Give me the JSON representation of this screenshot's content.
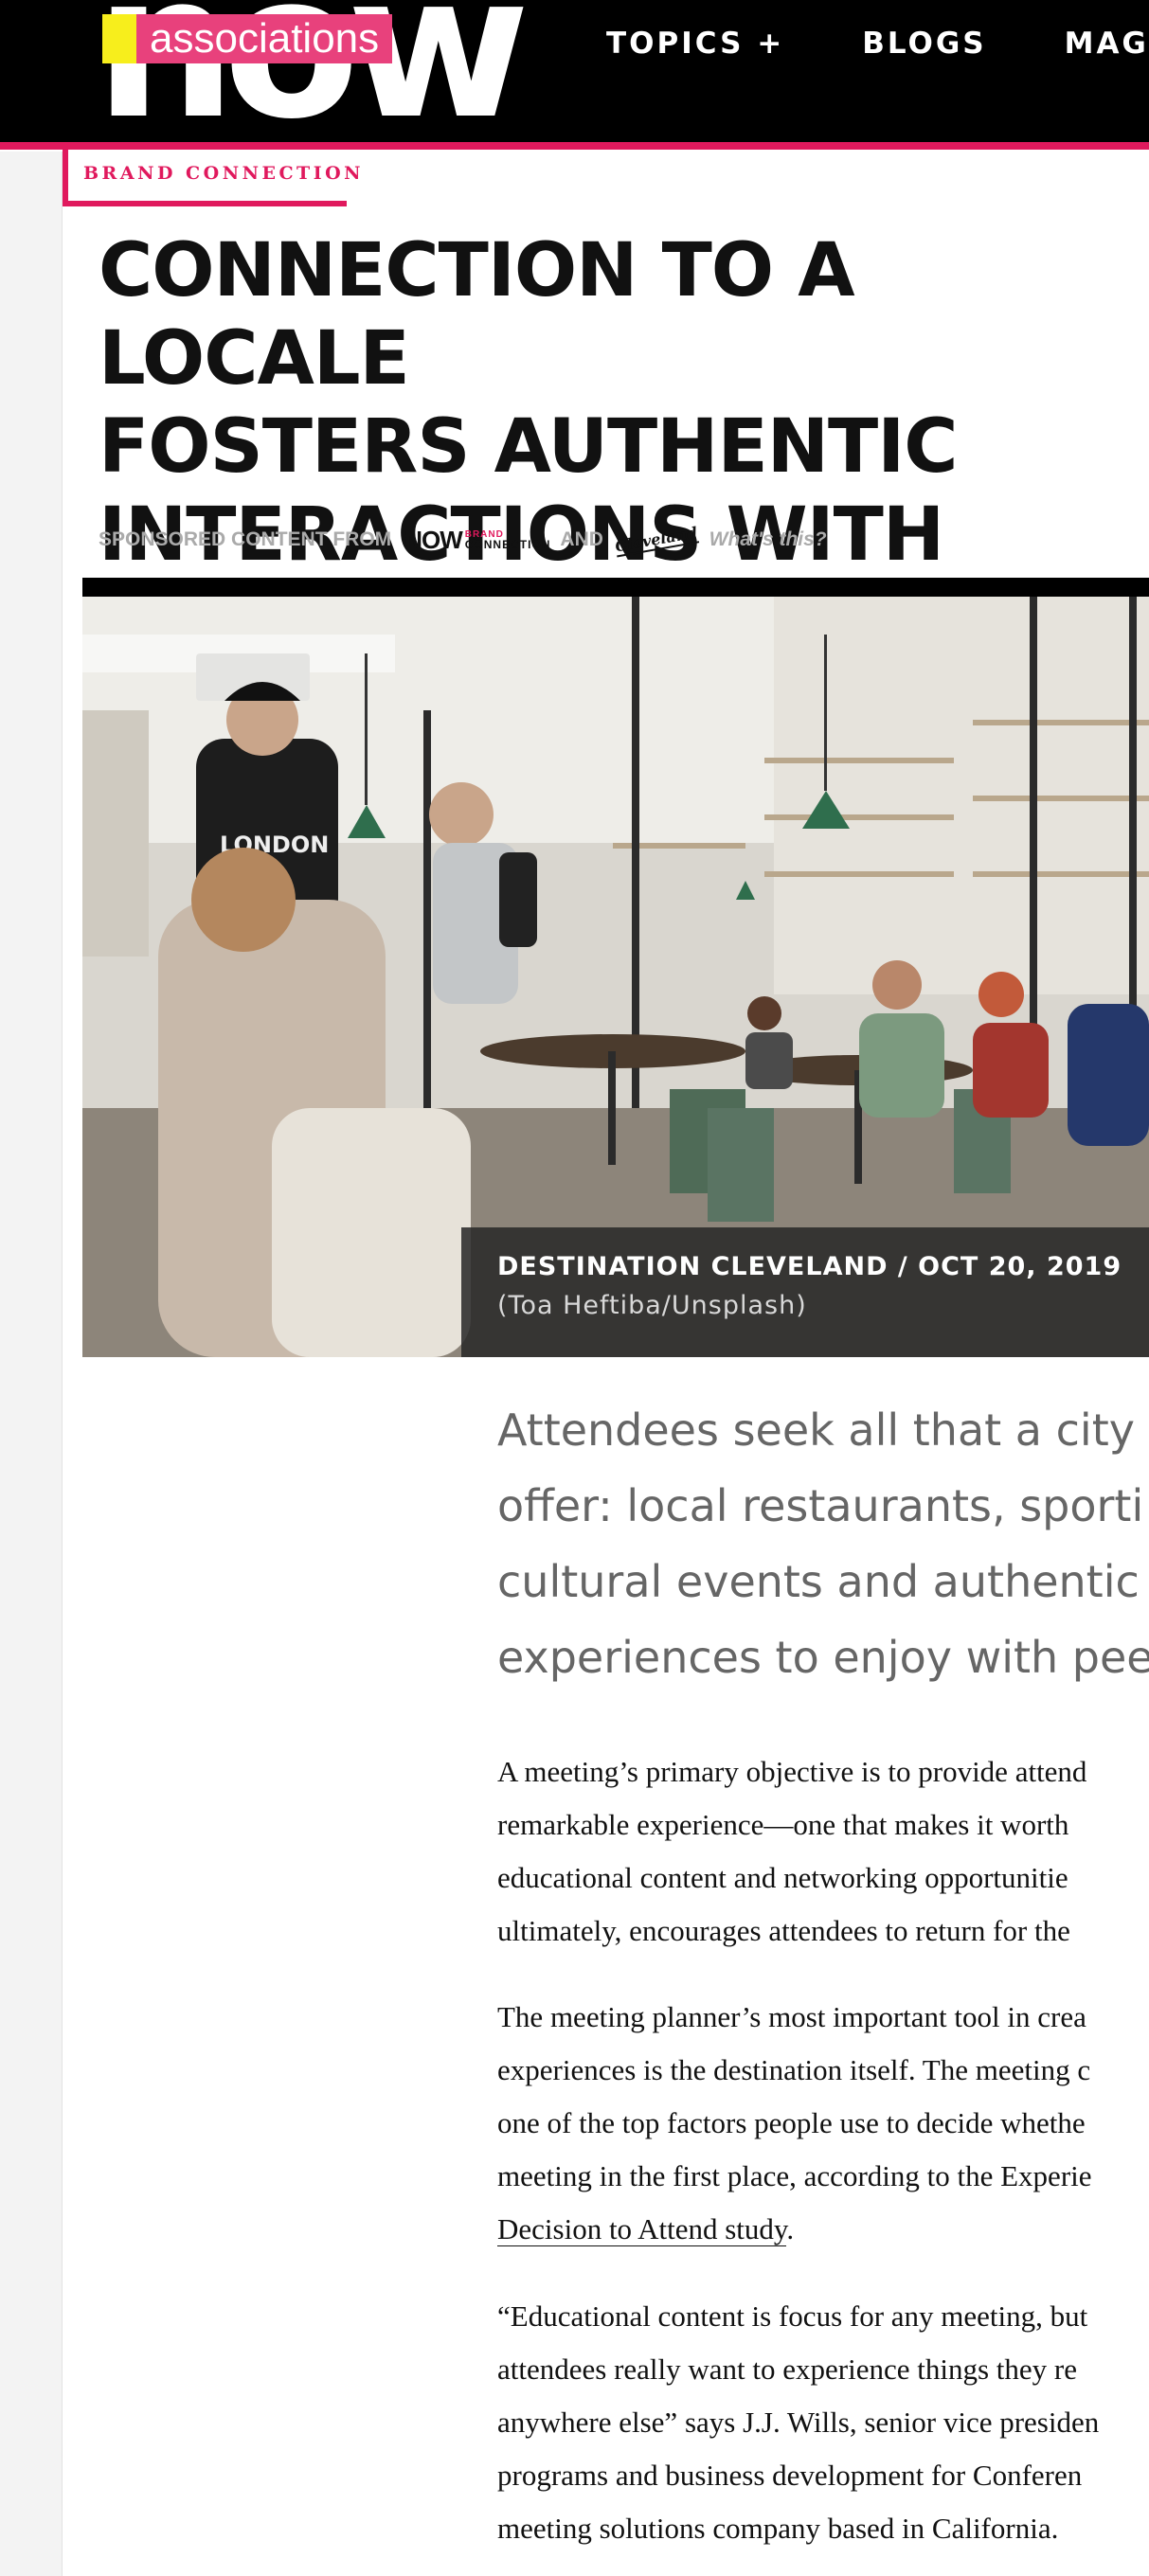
{
  "header": {
    "logo": {
      "wordmark": "now",
      "badge": "associations"
    },
    "nav": [
      "TOPICS +",
      "BLOGS",
      "MAGAZ"
    ]
  },
  "article": {
    "tag": "BRAND CONNECTION",
    "headline_lines": [
      "CONNECTION TO A LOCALE",
      "FOSTERS AUTHENTIC",
      "INTERACTIONS WITH PEERS"
    ],
    "sponsor": {
      "prefix": "SPONSORED CONTENT FROM",
      "brand_logo_main": "NOW",
      "brand_logo_top": "BRAND",
      "brand_logo_bottom": "CONNECTION",
      "and": "AND",
      "partner_logo": "Cleveland",
      "whats_this": "What's this?"
    },
    "hero": {
      "caption": "DESTINATION CLEVELAND / OCT 20, 2019",
      "credit": "(Toa Heftiba/Unsplash)",
      "shirt_text": "LONDON"
    },
    "dek_lines": [
      "Attendees seek all that a city h",
      "offer: local restaurants, sporti",
      "cultural events and authentic",
      "experiences to enjoy with peer"
    ],
    "paragraph1": [
      "A meeting’s primary objective is to provide attend",
      "remarkable experience—one that makes it worth",
      "educational content and networking opportunitie",
      "ultimately, encourages attendees to return for the"
    ],
    "paragraph2": [
      "The meeting planner’s most important tool in crea",
      "experiences is the destination itself. The meeting c",
      "one of the top factors people use to decide whethe",
      "meeting in the first place, according to the Experie"
    ],
    "paragraph2_link": "Decision to Attend study",
    "paragraph2_end": ".",
    "paragraph3": [
      "“Educational content is focus for any meeting, but",
      "attendees really want to experience things they re",
      "anywhere else” says J.J. Wills, senior vice presiden",
      "programs and business development for Conferen",
      "meeting solutions company based in California."
    ]
  },
  "colors": {
    "accent": "#e0195d",
    "logo_yellow": "#f7ee1c",
    "header_bg": "#000000"
  }
}
